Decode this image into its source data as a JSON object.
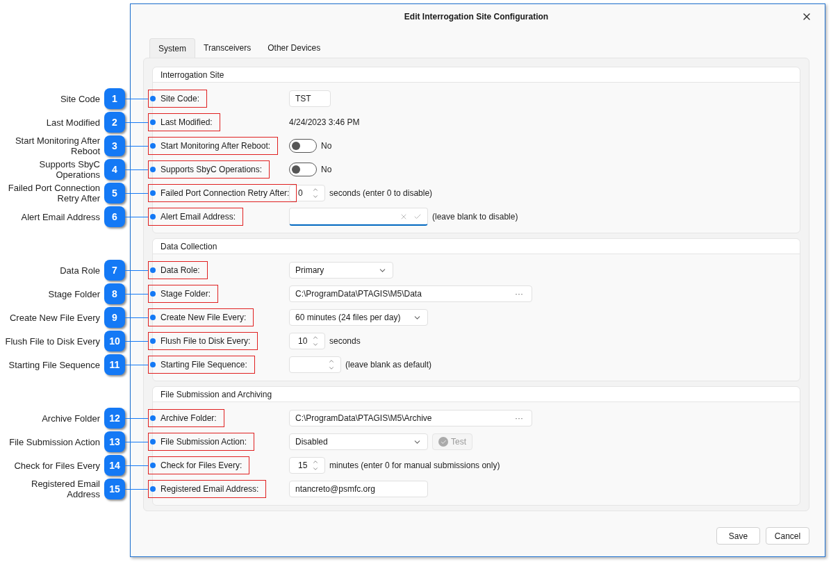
{
  "dialog": {
    "title": "Edit Interrogation Site Configuration"
  },
  "tabs": [
    {
      "label": "System",
      "selected": true
    },
    {
      "label": "Transceivers",
      "selected": false
    },
    {
      "label": "Other Devices",
      "selected": false
    }
  ],
  "sections": [
    {
      "title": "Interrogation Site",
      "fields": [
        {
          "kind": "code",
          "callout": {
            "number": "1",
            "text": "Site Code"
          },
          "label": "Site Code:",
          "value": "TST"
        },
        {
          "kind": "static",
          "callout": {
            "number": "2",
            "text": "Last Modified"
          },
          "label": "Last Modified:",
          "value": "4/24/2023 3:46 PM"
        },
        {
          "kind": "toggle",
          "callout": {
            "number": "3",
            "text": "Start Monitoring After Reboot"
          },
          "label": "Start Monitoring After Reboot:",
          "on": false,
          "state_text": "No"
        },
        {
          "kind": "toggle",
          "callout": {
            "number": "4",
            "text": "Supports SbyC Operations"
          },
          "label": "Supports SbyC Operations:",
          "on": false,
          "state_text": "No"
        },
        {
          "kind": "spinner",
          "callout": {
            "number": "5",
            "text": "Failed Port Connection Retry After"
          },
          "label": "Failed Port Connection Retry After:",
          "value": "0",
          "suffix": "seconds (enter 0 to disable)"
        },
        {
          "kind": "combo",
          "callout": {
            "number": "6",
            "text": "Alert Email Address"
          },
          "label": "Alert Email Address:",
          "suffix": "(leave blank to disable)"
        }
      ]
    },
    {
      "title": "Data Collection",
      "fields": [
        {
          "kind": "short_select",
          "callout": {
            "number": "7",
            "text": "Data Role"
          },
          "label": "Data Role:",
          "value": "Primary"
        },
        {
          "kind": "path",
          "callout": {
            "number": "8",
            "text": "Stage Folder"
          },
          "label": "Stage Folder:",
          "value": "C:\\ProgramData\\PTAGIS\\M5\\Data",
          "button": "···"
        },
        {
          "kind": "select",
          "callout": {
            "number": "9",
            "text": "Create New File Every"
          },
          "label": "Create New File Every:",
          "value": "60 minutes (24 files per day)"
        },
        {
          "kind": "spinner",
          "callout": {
            "number": "10",
            "text": "Flush File to Disk Every"
          },
          "label": "Flush File to Disk Every:",
          "value": "10",
          "suffix": "seconds"
        },
        {
          "kind": "spinner",
          "callout": {
            "number": "11",
            "text": "Starting File Sequence"
          },
          "label": "Starting File Sequence:",
          "suffix": "(leave blank as default)"
        }
      ]
    },
    {
      "title": "File Submission and Archiving",
      "fields": [
        {
          "kind": "path",
          "callout": {
            "number": "12",
            "text": "Archive Folder"
          },
          "label": "Archive Folder:",
          "value": "C:\\ProgramData\\PTAGIS\\M5\\Archive",
          "button": "···"
        },
        {
          "kind": "select",
          "callout": {
            "number": "13",
            "text": "File Submission Action"
          },
          "label": "File Submission Action:",
          "value": "Disabled",
          "action": {
            "label": "Test",
            "disabled": true
          }
        },
        {
          "kind": "spinner",
          "callout": {
            "number": "14",
            "text": "Check for Files Every"
          },
          "label": "Check for Files Every:",
          "value": "15",
          "suffix": "minutes (enter 0 for manual submissions only)"
        },
        {
          "kind": "text",
          "callout": {
            "number": "15",
            "text": "Registered Email Address"
          },
          "label": "Registered Email Address:",
          "value": "ntancreto@psmfc.org"
        }
      ]
    }
  ],
  "buttons": [
    "Save",
    "Cancel"
  ]
}
